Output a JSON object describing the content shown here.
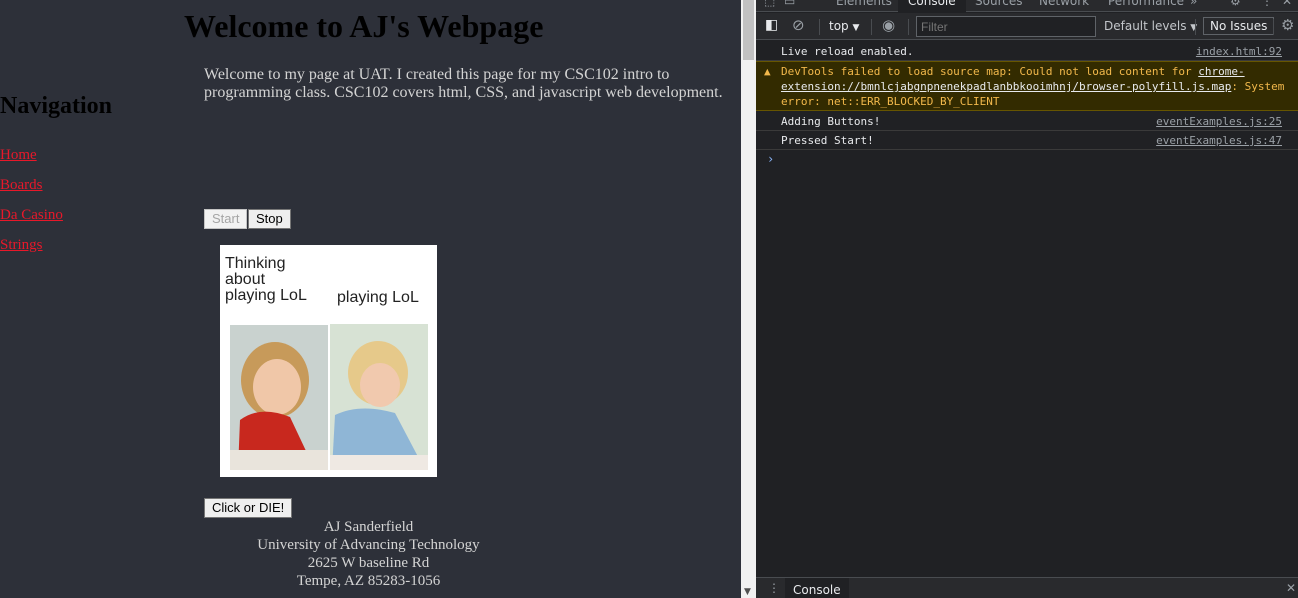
{
  "page": {
    "title": "Welcome to AJ's Webpage",
    "intro": "Welcome to my page at UAT. I created this page for my CSC102 intro to programming class. CSC102 covers html, CSS, and javascript web development.",
    "nav_heading": "Navigation",
    "nav_links": [
      "Home",
      "Boards",
      "Da Casino",
      "Strings"
    ],
    "start_label": "Start",
    "stop_label": "Stop",
    "meme": {
      "left_caption": [
        "Thinking",
        "about",
        "playing LoL"
      ],
      "right_caption": "playing LoL"
    },
    "click_label": "Click or DIE!",
    "footer": [
      "AJ Sanderfield",
      "University of Advancing Technology",
      "2625 W baseline Rd",
      "Tempe, AZ 85283-1056"
    ]
  },
  "devtools": {
    "tabs": [
      "Elements",
      "Console",
      "Sources",
      "Network",
      "Performance"
    ],
    "active_tab": "Console",
    "context": "top",
    "filter_placeholder": "Filter",
    "levels": "Default levels",
    "issues": "No Issues",
    "messages": [
      {
        "text": "Live reload enabled.",
        "source": "index.html:92"
      },
      {
        "level": "warning",
        "text_prefix": "DevTools failed to load source map: Could not load content for ",
        "link": "chrome-extension://bmnlcjabgnpnenekpadlanbbkooimhnj/browser-polyfill.js.map",
        "text_suffix": ": System error: net::ERR_BLOCKED_BY_CLIENT"
      },
      {
        "text": "Adding Buttons!",
        "source": "eventExamples.js:25"
      },
      {
        "text": "Pressed Start!",
        "source": "eventExamples.js:47"
      }
    ],
    "drawer_tab": "Console"
  },
  "colors": {
    "page_bg": "#2d3039",
    "link": "#e8182a",
    "devtools_bg": "#202124",
    "warning": "#f2b84b"
  }
}
